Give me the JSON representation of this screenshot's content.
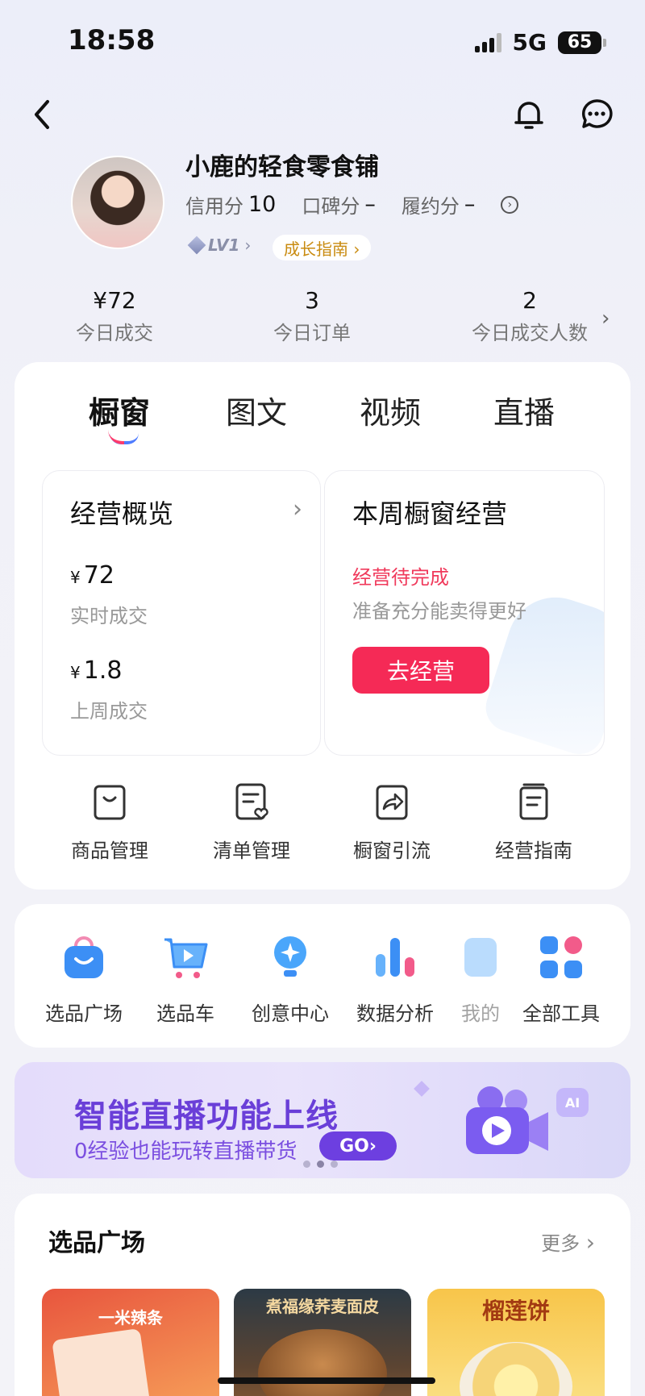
{
  "status_bar": {
    "time": "18:58",
    "network": "5G",
    "battery": "65"
  },
  "profile": {
    "shop_name": "小鹿的轻食零食铺",
    "credit_label": "信用分",
    "credit_value": "10",
    "reputation_label": "口碑分",
    "reputation_value": "–",
    "fulfillment_label": "履约分",
    "fulfillment_value": "–",
    "level": "LV1",
    "growth_guide": "成长指南 ›"
  },
  "stats": [
    {
      "value": "¥72",
      "label": "今日成交"
    },
    {
      "value": "3",
      "label": "今日订单"
    },
    {
      "value": "2",
      "label": "今日成交人数"
    }
  ],
  "tabs": [
    "橱窗",
    "图文",
    "视频",
    "直播"
  ],
  "overview": {
    "title": "经营概览",
    "realtime_currency": "¥",
    "realtime_value": "72",
    "realtime_label": "实时成交",
    "lastweek_currency": "¥",
    "lastweek_value": "1.8",
    "lastweek_label": "上周成交"
  },
  "weekly": {
    "title": "本周橱窗经营",
    "status": "经营待完成",
    "hint": "准备充分能卖得更好",
    "button": "去经营"
  },
  "tools": [
    {
      "label": "商品管理",
      "icon": "bag-outline-icon"
    },
    {
      "label": "清单管理",
      "icon": "list-heart-icon"
    },
    {
      "label": "橱窗引流",
      "icon": "share-icon"
    },
    {
      "label": "经营指南",
      "icon": "guide-book-icon"
    }
  ],
  "apps": [
    {
      "label": "选品广场",
      "icon": "shopping-bag-icon"
    },
    {
      "label": "选品车",
      "icon": "cart-icon"
    },
    {
      "label": "创意中心",
      "icon": "lightbulb-icon"
    },
    {
      "label": "数据分析",
      "icon": "bar-chart-icon"
    },
    {
      "label": "我的",
      "icon": "my-icon"
    },
    {
      "label": "全部工具",
      "icon": "grid-icon"
    }
  ],
  "banner": {
    "title": "智能直播功能上线",
    "subtitle": "0经验也能玩转直播带货",
    "go": "GO›",
    "badge": "AI"
  },
  "selection": {
    "title": "选品广场",
    "more": "更多",
    "products": [
      {
        "caption": "一米辣条"
      },
      {
        "caption": "煮福缘荞麦面皮"
      },
      {
        "caption": "榴莲饼"
      }
    ]
  },
  "colors": {
    "accent": "#f52a56",
    "banner_purple": "#6a3fd8",
    "warning": "#f0395b"
  }
}
